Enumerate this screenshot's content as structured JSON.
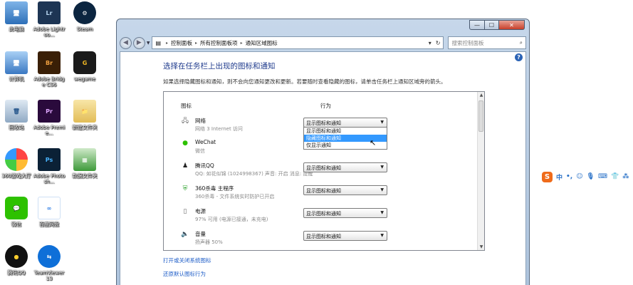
{
  "desktop": {
    "icons": [
      {
        "label": "此电脑"
      },
      {
        "label": "Adobe Lightroo..."
      },
      {
        "label": "Steam"
      },
      {
        "label": "计算机"
      },
      {
        "label": "Adobe Bridge CS6"
      },
      {
        "label": "wegame"
      },
      {
        "label": "回收站"
      },
      {
        "label": "Adobe Premie..."
      },
      {
        "label": "新建文件夹"
      },
      {
        "label": "360游戏大厅"
      },
      {
        "label": "Adobe Photosh..."
      },
      {
        "label": "数据文件夹"
      },
      {
        "label": "微信"
      },
      {
        "label": "百度网盘"
      },
      {
        "label": "腾讯QQ"
      },
      {
        "label": "TeamViewer 13"
      }
    ],
    "icon_glyphs": [
      "Lr",
      "Br",
      "Pr",
      "Ps"
    ]
  },
  "window": {
    "buttons": {
      "minimize": "—",
      "maximize": "☐",
      "close": "✕"
    },
    "breadcrumb": [
      "控制面板",
      "所有控制面板项",
      "通知区域图标"
    ],
    "search_placeholder": "搜索控制面板",
    "title": "选择在任务栏上出现的图标和通知",
    "description": "如果选择隐藏图标和通知，则不会向您通知更改和更新。若要随时查看隐藏的图标，请单击任务栏上通知区域旁的箭头。",
    "col_icon": "图标",
    "col_behavior": "行为",
    "rows": [
      {
        "name": "网络",
        "sub": "网络 3 Internet 访问",
        "value": "显示图标和通知"
      },
      {
        "name": "WeChat",
        "sub": "微信",
        "value": ""
      },
      {
        "name": "腾讯QQ",
        "sub": "QQ: 如花似锦 (1024998367)  声音: 开启  消息: 提醒",
        "value": "显示图标和通知"
      },
      {
        "name": "360杀毒 主程序",
        "sub": "360杀毒 - 文件系统实时防护已开启",
        "value": "显示图标和通知"
      },
      {
        "name": "电源",
        "sub": "97% 可用 (电源已接通，未充电)",
        "value": "显示图标和通知"
      },
      {
        "name": "音量",
        "sub": "扬声器 50%",
        "value": "显示图标和通知"
      }
    ],
    "dropdown_options": [
      "显示图标和通知",
      "隐藏图标和通知",
      "仅显示通知"
    ],
    "dropdown_selected_index": 1,
    "links": [
      "打开或关闭系统图标",
      "还原默认图标行为"
    ]
  },
  "ime": {
    "items": [
      "中",
      "•,",
      "☺",
      "🎙",
      "⌨",
      "👕",
      "⁂"
    ]
  },
  "colors": {
    "link": "#1f5ec8",
    "title": "#1e3a8c",
    "selection": "#3399ff"
  }
}
